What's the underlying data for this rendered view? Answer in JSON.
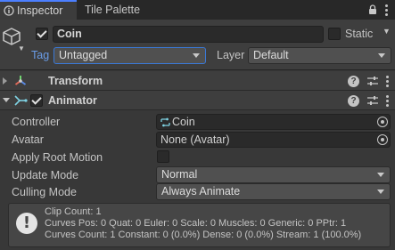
{
  "tabs": [
    {
      "label": "Inspector",
      "icon": "info-icon"
    },
    {
      "label": "Tile Palette"
    }
  ],
  "header": {
    "object_name": "Coin",
    "active": true,
    "static_label": "Static",
    "static": false,
    "tag_label": "Tag",
    "tag_value": "Untagged",
    "layer_label": "Layer",
    "layer_value": "Default"
  },
  "components": {
    "transform": {
      "title": "Transform",
      "expanded": false
    },
    "animator": {
      "title": "Animator",
      "expanded": true,
      "enabled": true
    }
  },
  "animator": {
    "controller_label": "Controller",
    "controller_value": "Coin",
    "avatar_label": "Avatar",
    "avatar_value": "None (Avatar)",
    "apply_root_motion_label": "Apply Root Motion",
    "apply_root_motion": false,
    "update_mode_label": "Update Mode",
    "update_mode_value": "Normal",
    "culling_mode_label": "Culling Mode",
    "culling_mode_value": "Always Animate"
  },
  "info": {
    "icon": "warning-exclamation-icon",
    "line1": "Clip Count: 1",
    "line2": "Curves Pos: 0 Quat: 0 Euler: 0 Scale: 0 Muscles: 0 Generic: 0 PPtr: 1",
    "line3": "Curves Count: 1 Constant: 0 (0.0%) Dense: 0 (0.0%) Stream: 1 (100.0%)"
  },
  "colors": {
    "accent_blue": "#4c7fff",
    "tag_label": "#6a9ce6",
    "transform_icon": "#6bd4e4",
    "animator_icon": "#7fd3e4"
  }
}
